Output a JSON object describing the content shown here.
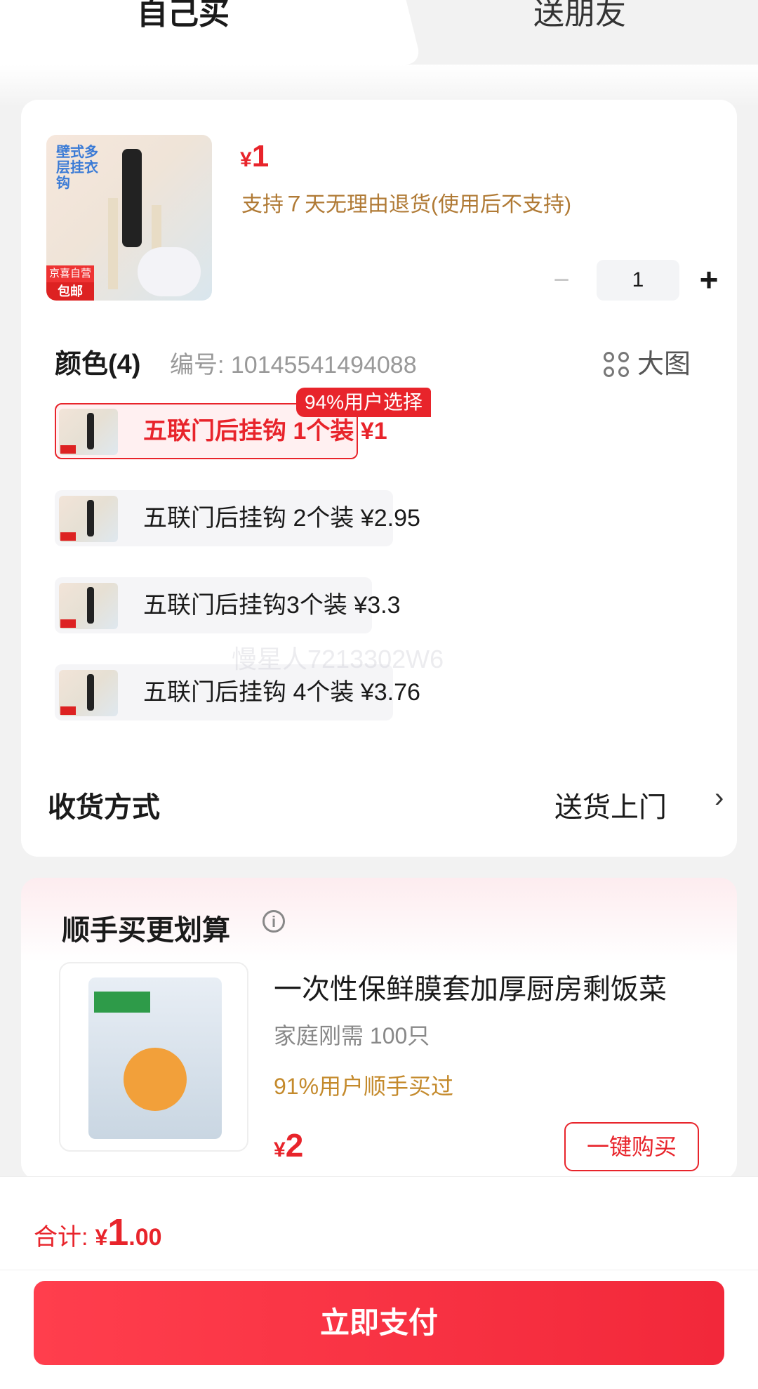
{
  "tabs": {
    "self_buy": "自己买",
    "gift": "送朋友"
  },
  "product": {
    "thumb_caption": "壁式多层挂衣钩",
    "thumb_badge_top": "京喜自营",
    "thumb_badge_bottom": "包邮",
    "price_symbol": "¥",
    "price": "1",
    "return_policy": "支持７天无理由退货(使用后不支持)",
    "quantity": "1"
  },
  "spec": {
    "title": "颜色(4)",
    "code": "编号: 10145541494088",
    "bigpic_label": "大图",
    "popular_tag": "94%用户选择",
    "options": [
      {
        "label": "五联门后挂钩 1个装  ¥1",
        "selected": true
      },
      {
        "label": "五联门后挂钩 2个装  ¥2.95",
        "selected": false
      },
      {
        "label": "五联门后挂钩3个装  ¥3.3",
        "selected": false
      },
      {
        "label": "五联门后挂钩 4个装  ¥3.76",
        "selected": false
      }
    ]
  },
  "watermark": "慢星人7213302W6",
  "delivery": {
    "label": "收货方式",
    "value": "送货上门"
  },
  "addon": {
    "title": "顺手买更划算",
    "name": "一次性保鲜膜套加厚厨房剩饭菜",
    "sub": "家庭刚需 100只",
    "stat": "91%用户顺手买过",
    "price_symbol": "¥",
    "price": "2",
    "buy_label": "一键购买"
  },
  "footer": {
    "total_label": "合计:",
    "total_symbol": "¥",
    "total_int": "1",
    "total_dec": ".00",
    "pay_label": "立即支付"
  },
  "colors": {
    "accent": "#e8242b",
    "gold": "#b07a35"
  }
}
